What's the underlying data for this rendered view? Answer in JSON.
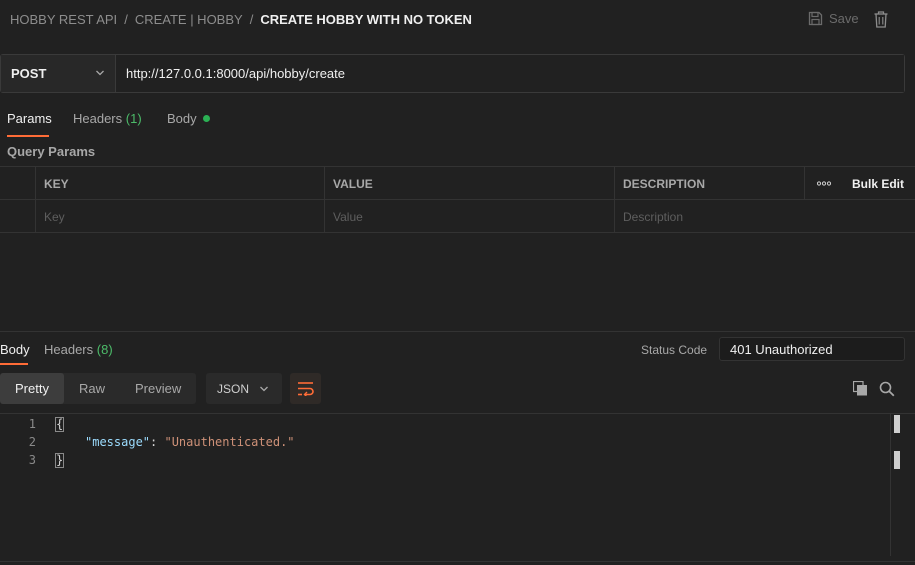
{
  "breadcrumb": {
    "items": [
      "HOBBY REST API",
      "CREATE | HOBBY"
    ],
    "separator": "/",
    "current": "CREATE HOBBY WITH NO TOKEN"
  },
  "toolbar": {
    "save_label": "Save"
  },
  "request": {
    "method": "POST",
    "url": "http://127.0.0.1:8000/api/hobby/create"
  },
  "request_tabs": {
    "params": "Params",
    "headers": "Headers",
    "headers_count": "(1)",
    "body": "Body"
  },
  "query_params": {
    "label": "Query Params",
    "columns": {
      "key": "KEY",
      "value": "VALUE",
      "description": "DESCRIPTION"
    },
    "more": "ooo",
    "bulk_edit": "Bulk Edit",
    "placeholders": {
      "key": "Key",
      "value": "Value",
      "description": "Description"
    }
  },
  "response": {
    "tabs": {
      "body": "Body",
      "headers": "Headers",
      "headers_count": "(8)"
    },
    "status_label": "Status Code",
    "status_value": "401 Unauthorized",
    "formats": [
      "Pretty",
      "Raw",
      "Preview"
    ],
    "active_format": "Pretty",
    "language": "JSON",
    "lines": {
      "n1": "1",
      "n2": "2",
      "n3": "3",
      "open": "{",
      "key": "\"message\"",
      "colon": ": ",
      "value": "\"Unauthenticated.\"",
      "close": "}"
    }
  },
  "colors": {
    "accent": "#ff6c37",
    "count_green": "#4cbb69",
    "json_key": "#9cdcfe",
    "json_string": "#ce9178"
  },
  "icons": [
    "save-icon",
    "trash-icon",
    "chevron-down-icon",
    "wrap-lines-icon",
    "copy-icon",
    "search-icon"
  ]
}
